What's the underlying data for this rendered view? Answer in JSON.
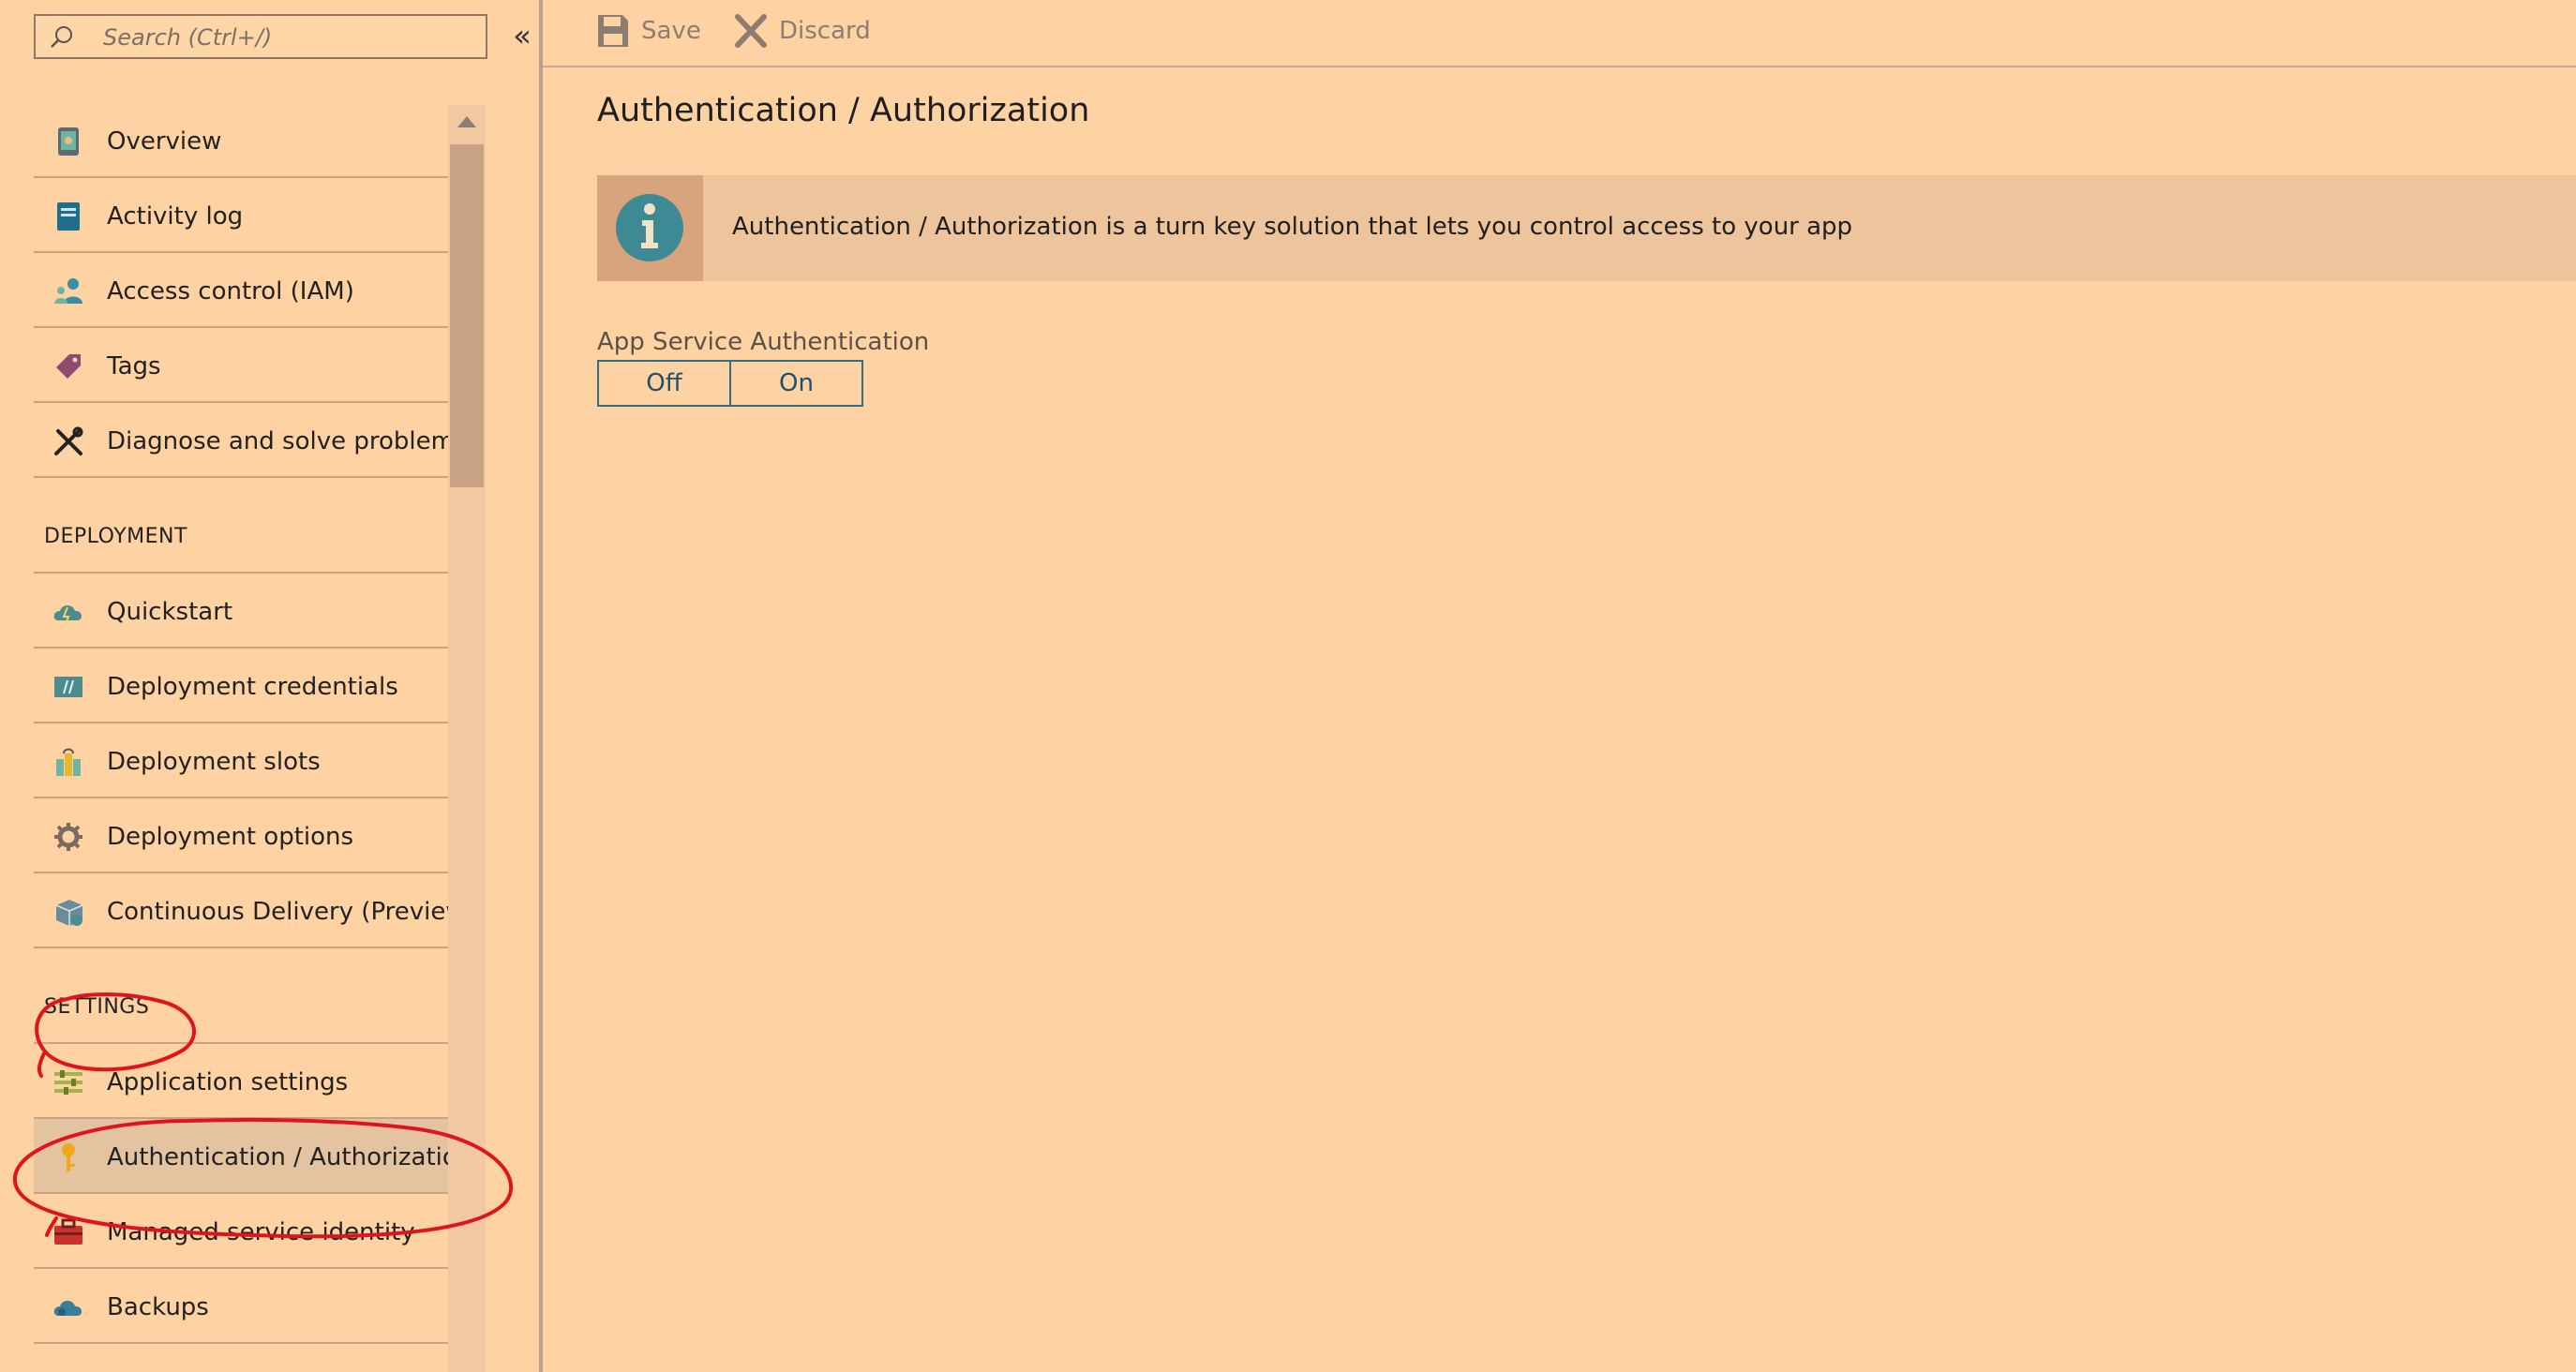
{
  "search": {
    "placeholder": "Search (Ctrl+/)",
    "icon": "search-icon"
  },
  "sidebar": {
    "collapse_label": "«",
    "groups": [
      {
        "items": [
          {
            "label": "Overview",
            "icon": "overview-icon"
          },
          {
            "label": "Activity log",
            "icon": "activity-log-icon"
          },
          {
            "label": "Access control (IAM)",
            "icon": "access-control-icon"
          },
          {
            "label": "Tags",
            "icon": "tag-icon"
          },
          {
            "label": "Diagnose and solve problems",
            "icon": "wrench-icon"
          }
        ]
      },
      {
        "section": "DEPLOYMENT",
        "items": [
          {
            "label": "Quickstart",
            "icon": "quickstart-cloud-icon"
          },
          {
            "label": "Deployment credentials",
            "icon": "credentials-icon"
          },
          {
            "label": "Deployment slots",
            "icon": "slots-icon"
          },
          {
            "label": "Deployment options",
            "icon": "gear-icon"
          },
          {
            "label": "Continuous Delivery (Preview)",
            "icon": "delivery-box-icon"
          }
        ]
      },
      {
        "section": "SETTINGS",
        "items": [
          {
            "label": "Application settings",
            "icon": "app-settings-icon"
          },
          {
            "label": "Authentication / Authorization",
            "icon": "key-icon",
            "active": true
          },
          {
            "label": "Managed service identity",
            "icon": "toolbox-icon"
          },
          {
            "label": "Backups",
            "icon": "cloud-backup-icon"
          }
        ]
      }
    ]
  },
  "toolbar": {
    "save_label": "Save",
    "discard_label": "Discard"
  },
  "main": {
    "title": "Authentication / Authorization",
    "info_text": "Authentication / Authorization is a turn key solution that lets you control access to your app",
    "auth_label": "App Service Authentication",
    "toggle_off": "Off",
    "toggle_on": "On"
  },
  "colors": {
    "background": "#ffd2a3",
    "accent": "#2f6f87",
    "annotation": "#e0141e",
    "active_item": "#e4c3a0"
  }
}
